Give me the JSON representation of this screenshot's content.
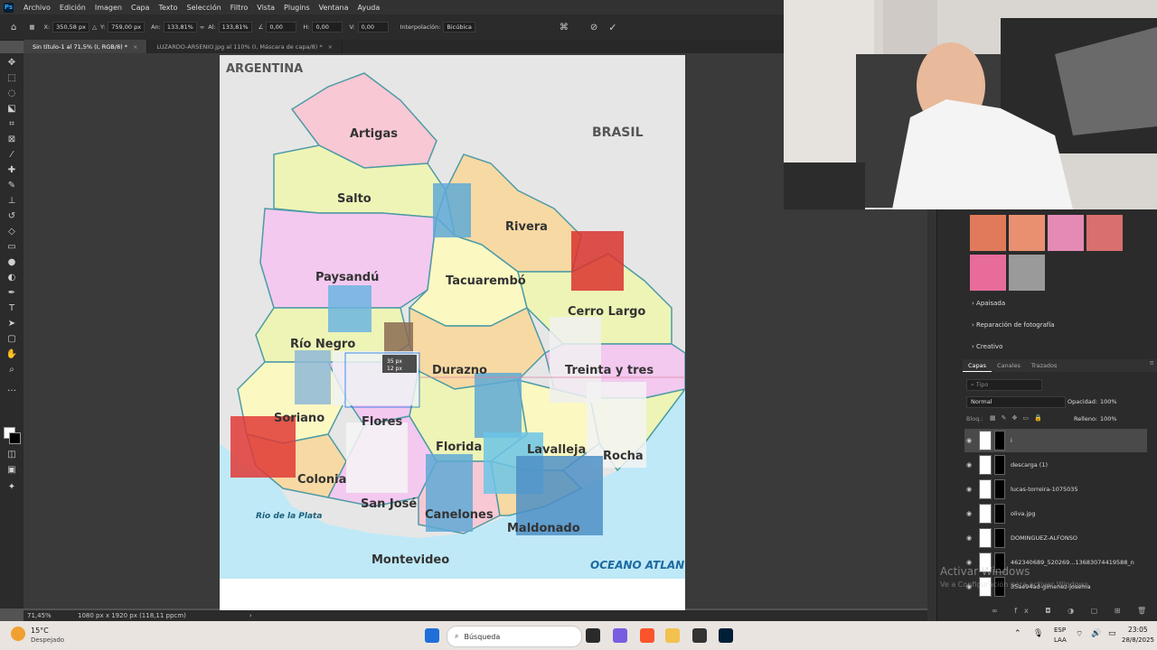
{
  "menu": [
    "Archivo",
    "Edición",
    "Imagen",
    "Capa",
    "Texto",
    "Selección",
    "Filtro",
    "Vista",
    "Plugins",
    "Ventana",
    "Ayuda"
  ],
  "app_logo": "Ps",
  "options": {
    "x_label": "X:",
    "x_value": "350,58 px",
    "y_label": "Y:",
    "y_value": "759,00 px",
    "w_label": "An:",
    "w_value": "133,81%",
    "h_label": "Al:",
    "h_value": "133,81%",
    "angle_value": "0,00",
    "hskew_label": "H:",
    "hskew_value": "0,00",
    "vskew_label": "V:",
    "vskew_value": "0,00",
    "interp_label": "Interpolación:",
    "interp_value": "Bicúbica"
  },
  "tabs": [
    {
      "label": "Sin título-1 al 71,5% (I, RGB/8) *",
      "close": "×"
    },
    {
      "label": "LUZARDO-ARSENIO.jpg al 110% (I, Máscara de capa/8) *",
      "close": "×"
    }
  ],
  "map": {
    "countries": [
      "ARGENTINA",
      "BRASIL"
    ],
    "departments": [
      "Artigas",
      "Salto",
      "Rivera",
      "Paysandú",
      "Tacuarembó",
      "Cerro Largo",
      "Río Negro",
      "Durazno",
      "Treinta y tres",
      "Soriano",
      "Flores",
      "Florida",
      "Lavalleja",
      "Rocha",
      "Colonia",
      "San José",
      "Canelones",
      "Maldonado",
      "Montevideo"
    ],
    "water": [
      "Rio de la Plata",
      "OCEANO ATLANTICO"
    ],
    "dims": [
      "35 px",
      "12 px"
    ]
  },
  "status": {
    "zoom": "71,45%",
    "doc_size": "1080 px x 1920 px (118,11 ppcm)"
  },
  "panel": {
    "sections": [
      "Apaisada",
      "Reparación de fotografía",
      "Creativo"
    ],
    "layer_tabs": [
      "Capas",
      "Canales",
      "Trazados"
    ],
    "search_placeholder": "Tipo",
    "blend_mode": "Normal",
    "opacity_label": "Opacidad:",
    "opacity_value": "100%",
    "lock_label": "Bloq.:",
    "fill_label": "Relleno:",
    "fill_value": "100%",
    "layers": [
      "i",
      "descarga (1)",
      "lucas-torreira-1075035",
      "oliva.jpg",
      "DOMINGUEZ-ALFONSO",
      "462340689_520269...13683074419588_n",
      "35ae94ad-gimenez-josema"
    ]
  },
  "watermark": {
    "line1": "Activar Windows",
    "line2": "Ve a Configuración para activar Windows."
  },
  "taskbar": {
    "temp": "15°C",
    "weather": "Despejado",
    "search": "Búsqueda",
    "lang1": "ESP",
    "lang2": "LAA",
    "time": "23:05",
    "date": "28/8/2025"
  },
  "colors": {
    "rpanel": "#2b2b2b",
    "accent": "#31a8ff",
    "taskbar": "#e9e4e0"
  }
}
